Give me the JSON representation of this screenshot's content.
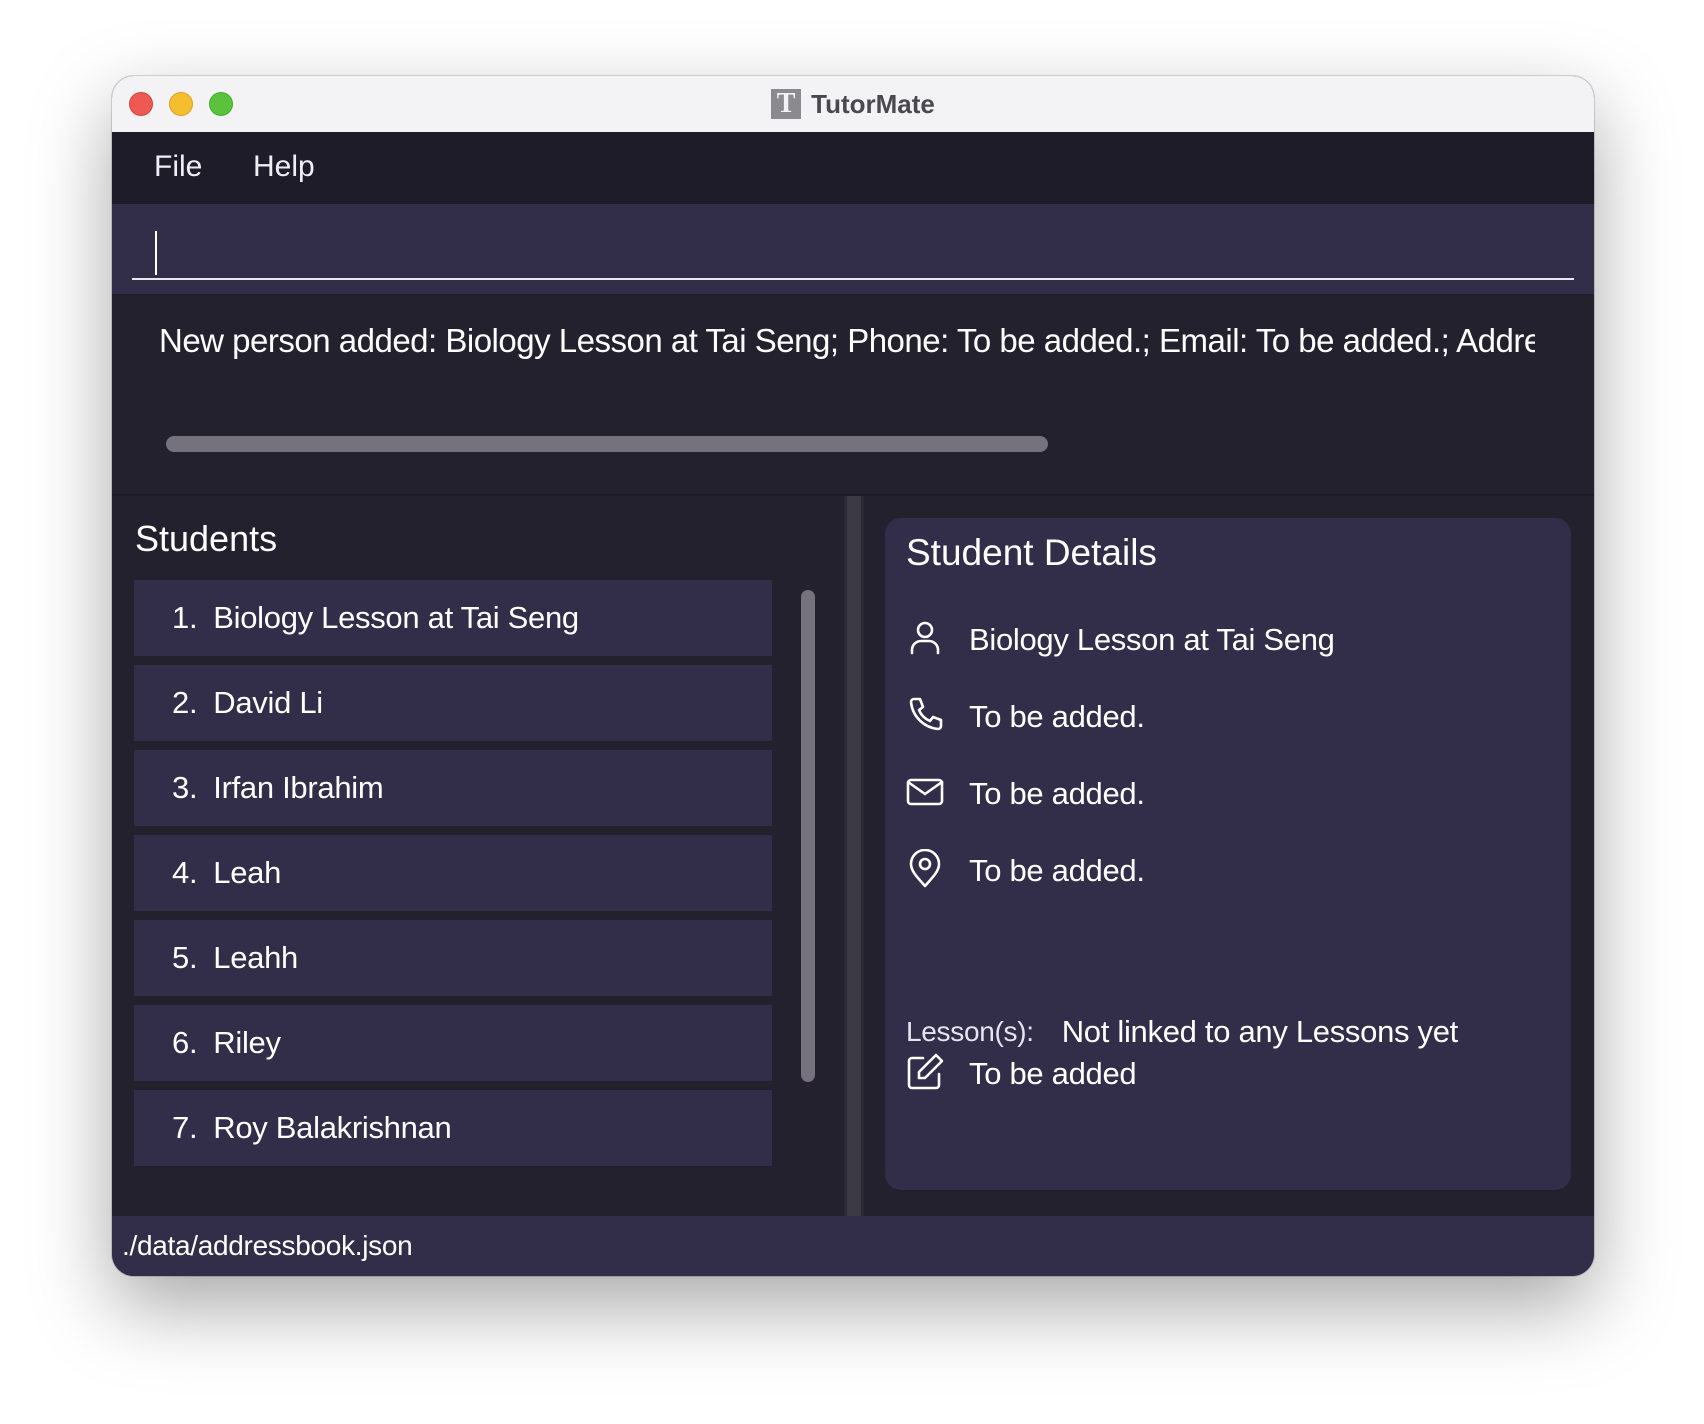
{
  "window": {
    "title": "TutorMate",
    "app_icon_letter": "T"
  },
  "menu": {
    "items": [
      {
        "label": "File"
      },
      {
        "label": "Help"
      }
    ]
  },
  "command_box": {
    "value": ""
  },
  "result_display": {
    "text": "New person added: Biology Lesson at Tai Seng; Phone: To be added.; Email: To be added.; Address: To be added."
  },
  "students_panel": {
    "title": "Students",
    "items": [
      {
        "index": "1.",
        "name": "Biology Lesson at Tai Seng"
      },
      {
        "index": "2.",
        "name": "David Li"
      },
      {
        "index": "3.",
        "name": "Irfan Ibrahim"
      },
      {
        "index": "4.",
        "name": "Leah"
      },
      {
        "index": "5.",
        "name": "Leahh"
      },
      {
        "index": "6.",
        "name": "Riley"
      },
      {
        "index": "7.",
        "name": "Roy Balakrishnan"
      }
    ]
  },
  "details_panel": {
    "title": "Student Details",
    "name": "Biology Lesson at Tai Seng",
    "phone": "To be added.",
    "email": "To be added.",
    "address": "To be added.",
    "lessons_label": "Lesson(s):",
    "lessons_value": "Not linked to any Lessons yet",
    "remark": "To be added",
    "icons": [
      "person-icon",
      "phone-icon",
      "mail-icon",
      "location-pin-icon",
      "edit-icon"
    ]
  },
  "status_bar": {
    "file_path": "./data/addressbook.json"
  },
  "colors": {
    "background_dark": "#24212f",
    "menubar": "#1f1c2a",
    "panel": "#322d48",
    "text": "#ffffff",
    "scrollbar": "#75727e"
  }
}
